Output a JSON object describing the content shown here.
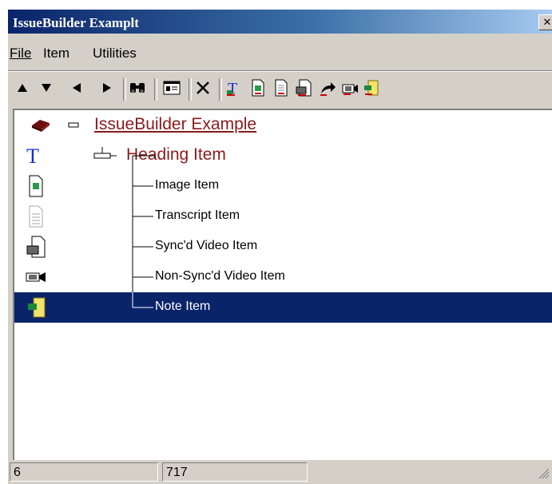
{
  "window": {
    "title": "IssueBuilder Examplt",
    "close_glyph": "✕"
  },
  "menu": [
    {
      "label": "File"
    },
    {
      "label": "Item"
    },
    {
      "label": "Utilities"
    }
  ],
  "toolbar": {
    "buttons": [
      {
        "name": "move-up-button",
        "icon": "arrow-up-icon"
      },
      {
        "name": "move-down-button",
        "icon": "arrow-down-icon"
      },
      {
        "name": "move-left-button",
        "icon": "arrow-left-icon"
      },
      {
        "name": "move-right-button",
        "icon": "arrow-right-icon"
      },
      {
        "name": "find-button",
        "icon": "binoculars-icon"
      },
      {
        "name": "properties-button",
        "icon": "properties-icon"
      },
      {
        "name": "delete-button",
        "icon": "delete-icon"
      },
      {
        "name": "add-heading-button",
        "icon": "heading-icon"
      },
      {
        "name": "add-image-button",
        "icon": "image-icon"
      },
      {
        "name": "add-transcript-button",
        "icon": "transcript-icon"
      },
      {
        "name": "add-synced-video-button",
        "icon": "synced-video-icon"
      },
      {
        "name": "add-link-button",
        "icon": "link-arrow-icon"
      },
      {
        "name": "add-non-synced-video-button",
        "icon": "non-synced-video-icon"
      },
      {
        "name": "add-note-button",
        "icon": "note-icon"
      }
    ]
  },
  "tree": {
    "root": {
      "label": "IssueBuilder Example",
      "icon": "book-icon"
    },
    "heading": {
      "label": "Heading Item",
      "icon": "heading-icon"
    },
    "children": [
      {
        "label": "Image Item",
        "icon": "image-icon"
      },
      {
        "label": "Transcript Item",
        "icon": "transcript-icon"
      },
      {
        "label": "Sync'd Video Item",
        "icon": "synced-video-icon"
      },
      {
        "label": "Non-Sync'd Video Item",
        "icon": "non-synced-video-icon"
      },
      {
        "label": "Note Item",
        "icon": "note-icon",
        "selected": true
      }
    ]
  },
  "status": {
    "panel1": "6",
    "panel2": "717"
  },
  "colors": {
    "title_start": "#0a246a",
    "selection": "#0a246a",
    "tree_label": "#8b1a1a",
    "face": "#d4d0c8"
  }
}
